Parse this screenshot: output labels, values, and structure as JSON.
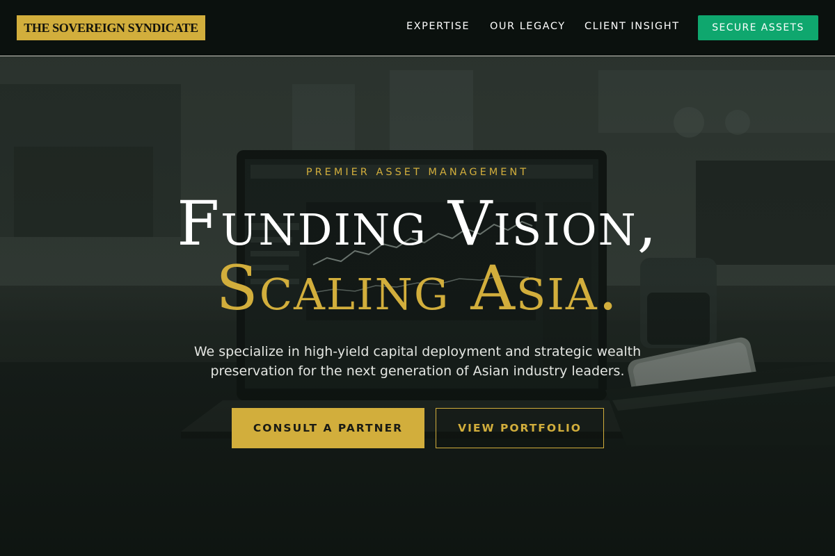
{
  "nav": {
    "brand": "THE SOVEREIGN SYNDICATE",
    "links": [
      "EXPERTISE",
      "OUR LEGACY",
      "CLIENT INSIGHT"
    ],
    "cta_label": "SECURE ASSETS"
  },
  "hero": {
    "eyebrow": "PREMIER ASSET MANAGEMENT",
    "headline_line1": "Funding Vision,",
    "headline_line2": "Scaling Asia.",
    "subtitle": "We specialize in high-yield capital deployment and strategic wealth preservation for the next generation of Asian industry leaders.",
    "primary_button": "CONSULT A PARTNER",
    "secondary_button": "VIEW PORTFOLIO",
    "background_image": "laptop-with-stock-chart-photo"
  },
  "colors": {
    "gold": "#d2ae3c",
    "green_cta": "#0fa76e",
    "nav_bg": "#0b110e",
    "text_light": "#ffffff"
  }
}
